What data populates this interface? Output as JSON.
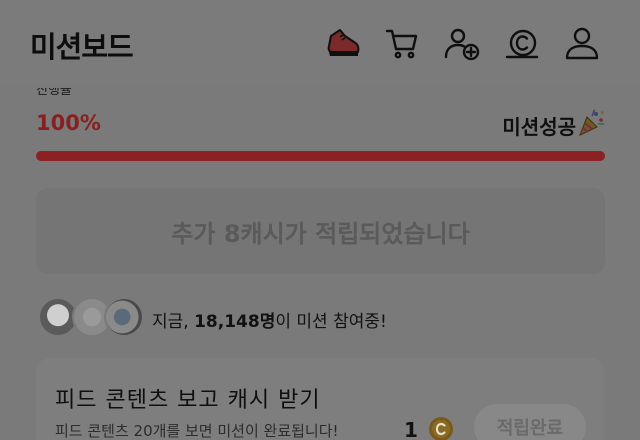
{
  "header": {
    "title": "미션보드",
    "icons": [
      "sneaker-icon",
      "cart-icon",
      "add-user-icon",
      "cash-coin-icon",
      "profile-icon"
    ]
  },
  "progress": {
    "caption": "진행율",
    "percent_text": "100%",
    "fraction": 1.0,
    "status_text": "미션성공",
    "accent_color": "#d6363a"
  },
  "notice": {
    "text": "추가 8캐시가 적립되었습니다"
  },
  "participants": {
    "prefix": "지금, ",
    "count": "18,148명",
    "suffix": "이 미션 참여중!"
  },
  "mission_card": {
    "title": "피드 콘텐츠 보고 캐시 받기",
    "description": "피드 콘텐츠 20개를 보면 미션이 완료됩니다!",
    "reward": "1",
    "button_label": "적립완료"
  }
}
